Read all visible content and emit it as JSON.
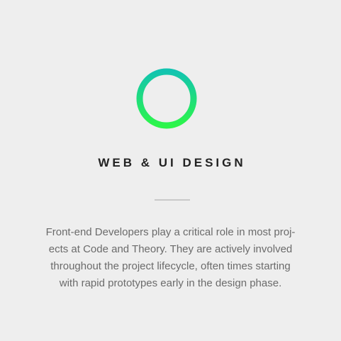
{
  "card": {
    "icon": "ring-icon",
    "title": "WEB & UI DESIGN",
    "description_lines": [
      "Front-end Developers play a critical role in most proj-",
      "ects at Code and Theory. They are actively involved",
      "throughout the project lifecycle, often times starting",
      "with rapid prototypes early in the design phase."
    ]
  },
  "colors": {
    "background": "#eeeeee",
    "ring_gradient_top": "#12c4b0",
    "ring_gradient_bottom": "#2cf54a",
    "title": "#222222",
    "divider": "#c9c9c9",
    "body_text": "#6b6b6b"
  }
}
